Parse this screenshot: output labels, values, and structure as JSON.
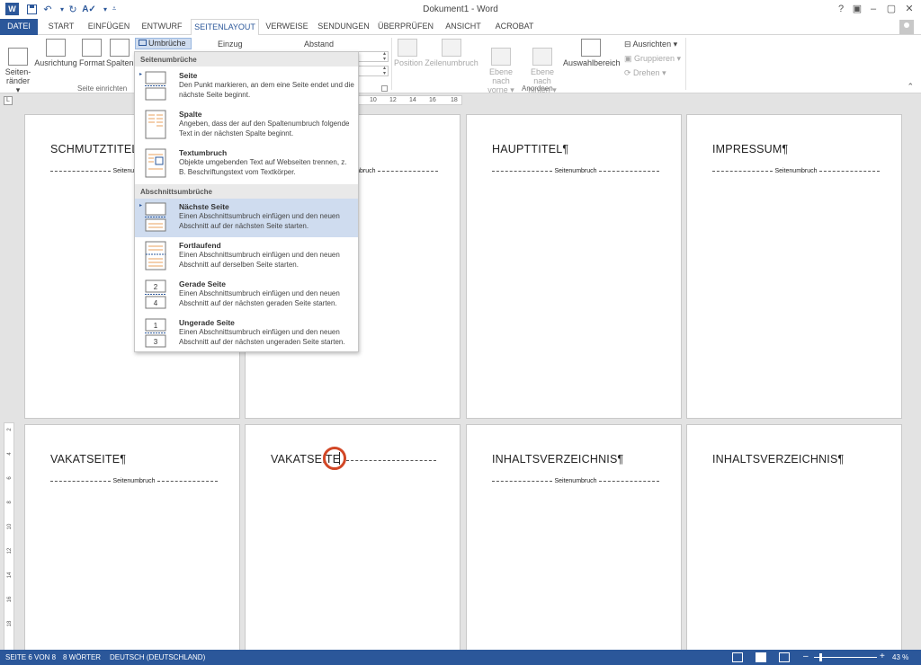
{
  "titlebar": {
    "title": "Dokument1 - Word",
    "app_icon": "W",
    "quick_access": [
      "save-icon",
      "undo-icon",
      "redo-icon",
      "spelling-icon",
      "customize-icon"
    ],
    "window_buttons": [
      "?",
      "▣",
      "–",
      "▢",
      "✕"
    ]
  },
  "tabs": {
    "file": "DATEI",
    "items": [
      "START",
      "EINFÜGEN",
      "ENTWURF",
      "SEITENLAYOUT",
      "VERWEISE",
      "SENDUNGEN",
      "ÜBERPRÜFEN",
      "ANSICHT",
      "ACROBAT"
    ],
    "active": "SEITENLAYOUT"
  },
  "ribbon": {
    "seitenraender": "Seiten-\nränder ▾",
    "ausrichtung": "Ausrichtung",
    "format": "Format",
    "spalten": "Spalten",
    "umbrueche": "Umbrüche ▾",
    "einzug": "Einzug",
    "abstand": "Abstand",
    "group_seite_einrichten": "Seite einrichten",
    "position": "Position",
    "zeilenumbruch": "Zeilenumbruch",
    "ebene_vorne": "Ebene nach\nvorne ▾",
    "ebene_hinten": "Ebene nach\nhinten ▾",
    "auswahlbereich": "Auswahlbereich",
    "ausrichten": "Ausrichten ▾",
    "gruppieren": "Gruppieren ▾",
    "drehen": "Drehen ▾",
    "group_anordnen": "Anordnen"
  },
  "ruler": {
    "corner": "L",
    "ticks": [
      "10",
      "12",
      "14",
      "16",
      "18"
    ],
    "vticks": [
      "2",
      "4",
      "6",
      "8",
      "10",
      "12",
      "14",
      "16",
      "18"
    ]
  },
  "breaks_menu": {
    "section_page": "Seitenumbrüche",
    "section_section": "Abschnittsumbrüche",
    "items": [
      {
        "title": "Seite",
        "desc": "Den Punkt markieren, an dem eine Seite endet und die nächste Seite beginnt.",
        "icon": "page-break-icon"
      },
      {
        "title": "Spalte",
        "desc": "Angeben, dass der auf den Spaltenumbruch folgende Text in der nächsten Spalte beginnt.",
        "icon": "column-break-icon"
      },
      {
        "title": "Textumbruch",
        "desc": "Objekte umgebenden Text auf Webseiten trennen, z. B. Beschriftungstext vom Textkörper.",
        "icon": "text-wrapping-break-icon"
      },
      {
        "title": "Nächste Seite",
        "desc": "Einen Abschnittsumbruch einfügen und den neuen Abschnitt auf der nächsten Seite starten.",
        "icon": "next-page-section-icon",
        "selected": true
      },
      {
        "title": "Fortlaufend",
        "desc": "Einen Abschnittsumbruch einfügen und den neuen Abschnitt auf derselben Seite starten.",
        "icon": "continuous-section-icon"
      },
      {
        "title": "Gerade Seite",
        "desc": "Einen Abschnittsumbruch einfügen und den neuen Abschnitt auf der nächsten geraden Seite starten.",
        "icon": "even-page-section-icon"
      },
      {
        "title": "Ungerade Seite",
        "desc": "Einen Abschnittsumbruch einfügen und den neuen Abschnitt auf der nächsten ungeraden Seite starten.",
        "icon": "odd-page-section-icon"
      }
    ]
  },
  "pages": [
    {
      "heading": "SCHMUTZTITEL¶",
      "break": "Seitenumbruch"
    },
    {
      "heading": "",
      "break": "Seitenumbruch"
    },
    {
      "heading": "HAUPTTITEL¶",
      "break": "Seitenumbruch"
    },
    {
      "heading": "IMPRESSUM¶",
      "break": "Seitenumbruch"
    },
    {
      "heading": "VAKATSEITE¶",
      "break": "Seitenumbruch"
    },
    {
      "heading": "VAKATSEITE",
      "break": ""
    },
    {
      "heading": "INHALTSVERZEICHNIS¶",
      "break": "Seitenumbruch"
    },
    {
      "heading": "INHALTSVERZEICHNIS¶",
      "break": ""
    }
  ],
  "status": {
    "page": "SEITE 6 VON 8",
    "words": "8 WÖRTER",
    "language": "DEUTSCH (DEUTSCHLAND)",
    "zoom_minus": "–",
    "zoom_plus": "+",
    "zoom": "43 %"
  },
  "colors": {
    "accent": "#2b579a",
    "selection": "#cfdcef",
    "highlight_circle": "#d24726"
  }
}
